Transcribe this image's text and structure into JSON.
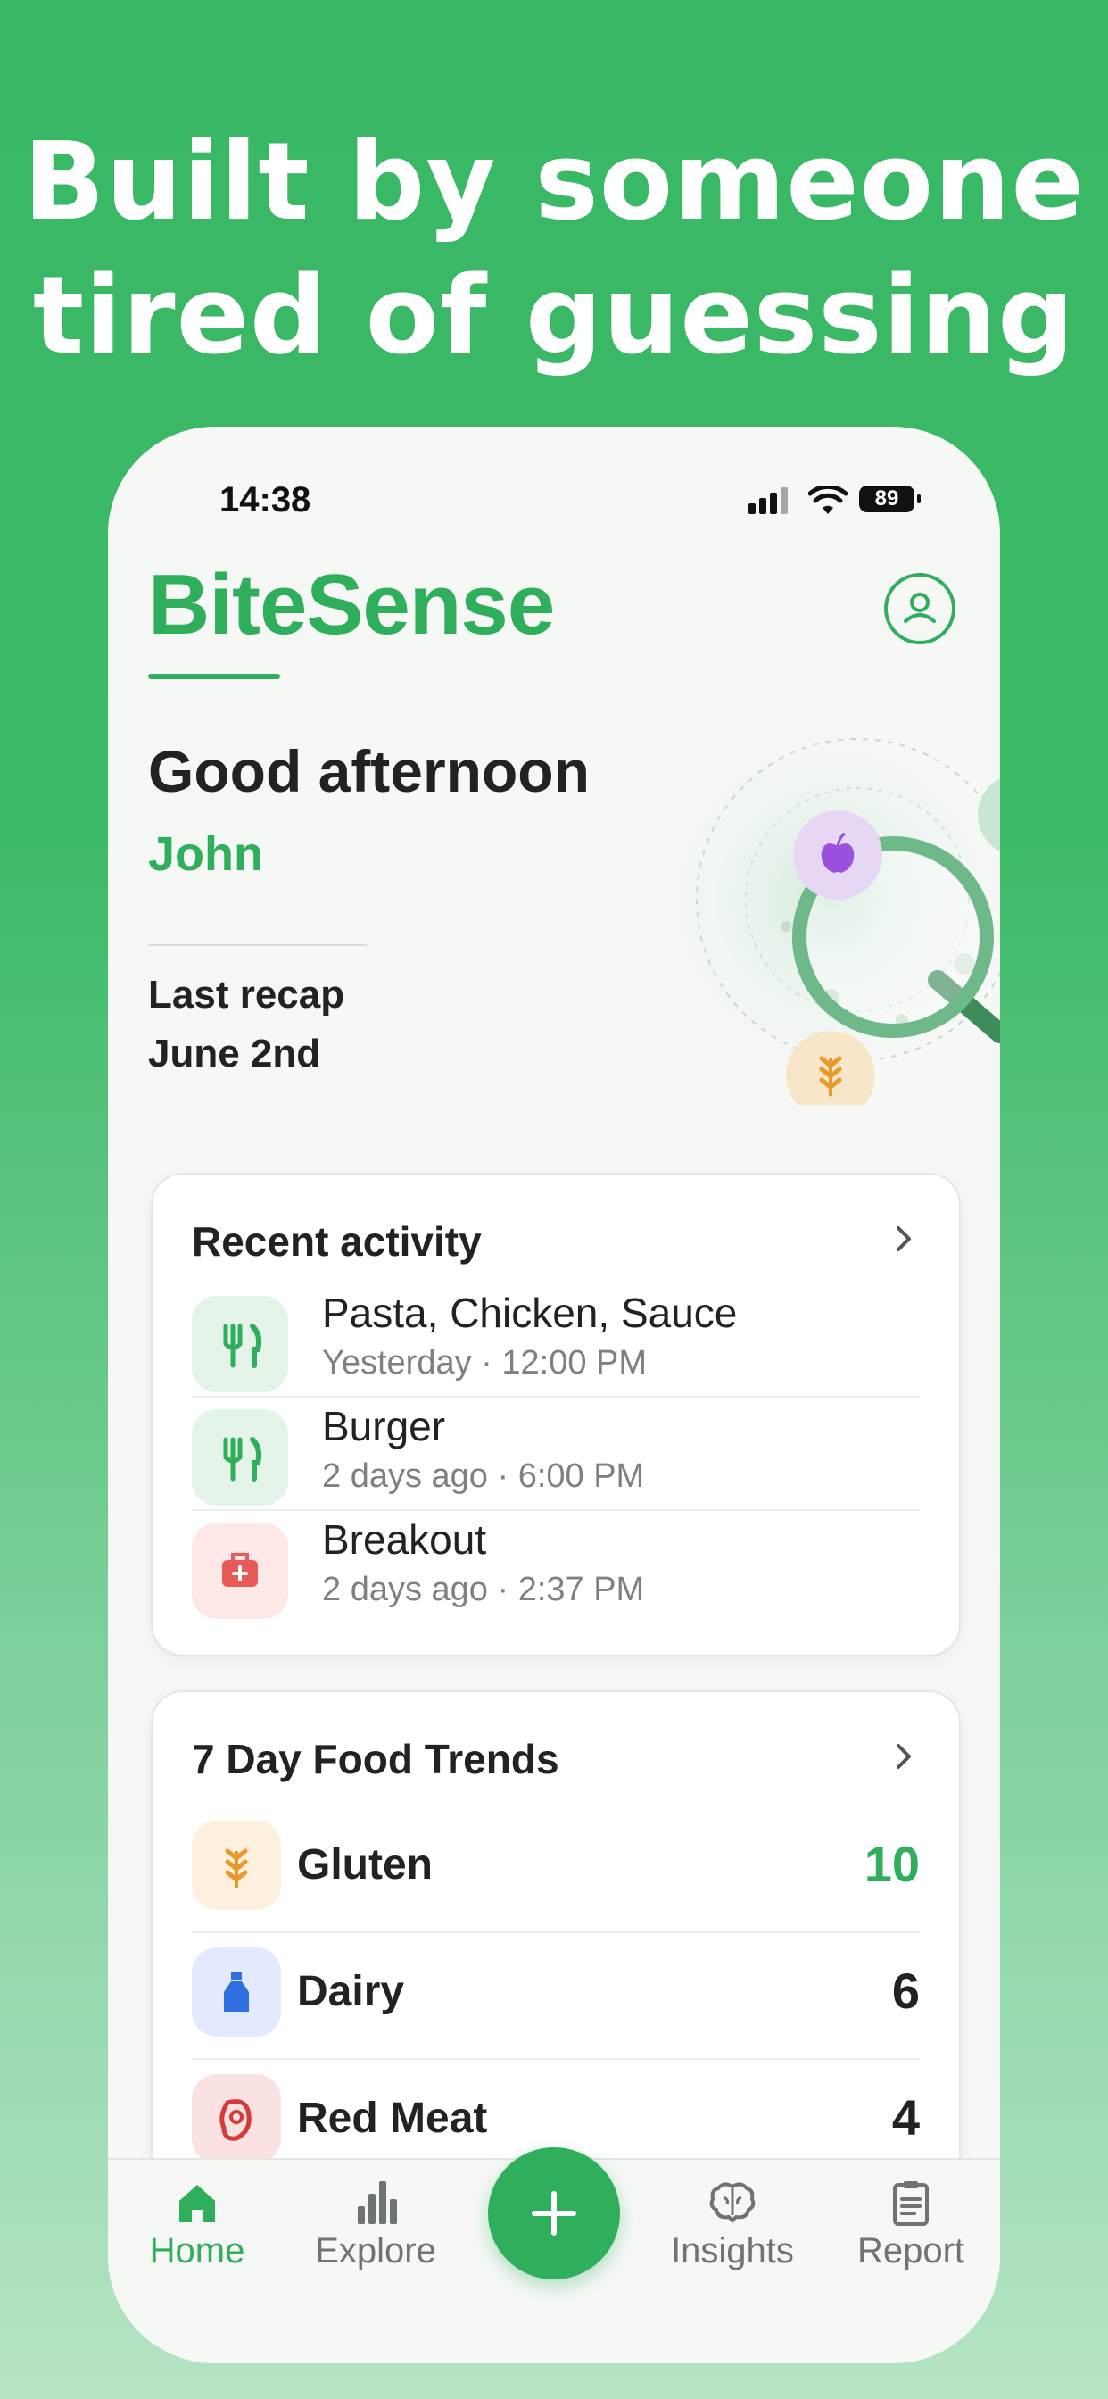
{
  "headline": [
    "Built by someone",
    "tired of guessing"
  ],
  "status": {
    "time": "14:38",
    "battery": "89"
  },
  "app": {
    "name": "BiteSense"
  },
  "greeting": {
    "text": "Good afternoon",
    "name": "John"
  },
  "recap": {
    "label": "Last recap",
    "date": "June 2nd"
  },
  "recent_activity": {
    "title": "Recent activity",
    "items": [
      {
        "title": "Pasta, Chicken, Sauce",
        "subtitle": "Yesterday · 12:00 PM",
        "icon": "fork-knife-icon",
        "type": "meal"
      },
      {
        "title": "Burger",
        "subtitle": "2 days ago · 6:00 PM",
        "icon": "fork-knife-icon",
        "type": "meal"
      },
      {
        "title": "Breakout",
        "subtitle": "2 days ago · 2:37 PM",
        "icon": "medical-kit-icon",
        "type": "symptom"
      }
    ]
  },
  "food_trends": {
    "title": "7 Day Food Trends",
    "items": [
      {
        "label": "Gluten",
        "value": "10",
        "icon": "wheat-icon",
        "highlight": true
      },
      {
        "label": "Dairy",
        "value": "6",
        "icon": "milk-bottle-icon",
        "highlight": false
      },
      {
        "label": "Red Meat",
        "value": "4",
        "icon": "steak-icon",
        "highlight": false
      }
    ]
  },
  "tabs": [
    {
      "label": "Home",
      "icon": "home-icon",
      "active": true
    },
    {
      "label": "Explore",
      "icon": "bar-chart-icon",
      "active": false
    },
    {
      "label": "Insights",
      "icon": "brain-icon",
      "active": false
    },
    {
      "label": "Report",
      "icon": "clipboard-icon",
      "active": false
    }
  ],
  "colors": {
    "brand": "#2fae5c",
    "background_top": "#38b764",
    "background_bottom": "#b6e4c5"
  }
}
